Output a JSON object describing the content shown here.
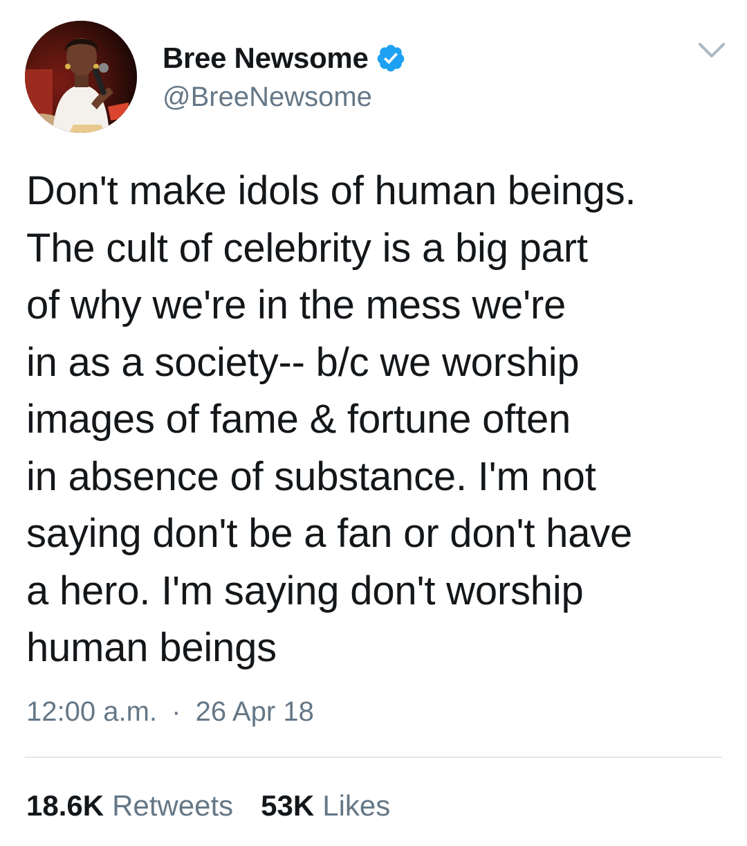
{
  "author": {
    "display_name": "Bree Newsome",
    "handle": "@BreeNewsome",
    "verified": true,
    "verified_color": "#1da1f2"
  },
  "tweet": {
    "lines": [
      "Don't make idols of human beings.",
      "The cult of celebrity is a big part",
      "of why we're in the mess we're",
      "in as a society-- b/c we worship",
      "images of fame & fortune often",
      "in absence of substance. I'm not",
      "saying don't be a fan or don't have",
      "a hero. I'm saying don't worship",
      "human beings"
    ],
    "time": "12:00 a.m.",
    "separator": "·",
    "date": "26 Apr 18"
  },
  "stats": {
    "retweets_count": "18.6K",
    "retweets_label": "Retweets",
    "likes_count": "53K",
    "likes_label": "Likes"
  },
  "icons": {
    "verified": "verified-badge-icon",
    "menu": "chevron-down-icon"
  },
  "colors": {
    "text_primary": "#14171a",
    "text_secondary": "#657786",
    "divider": "#e1e8ed",
    "accent": "#1da1f2"
  }
}
